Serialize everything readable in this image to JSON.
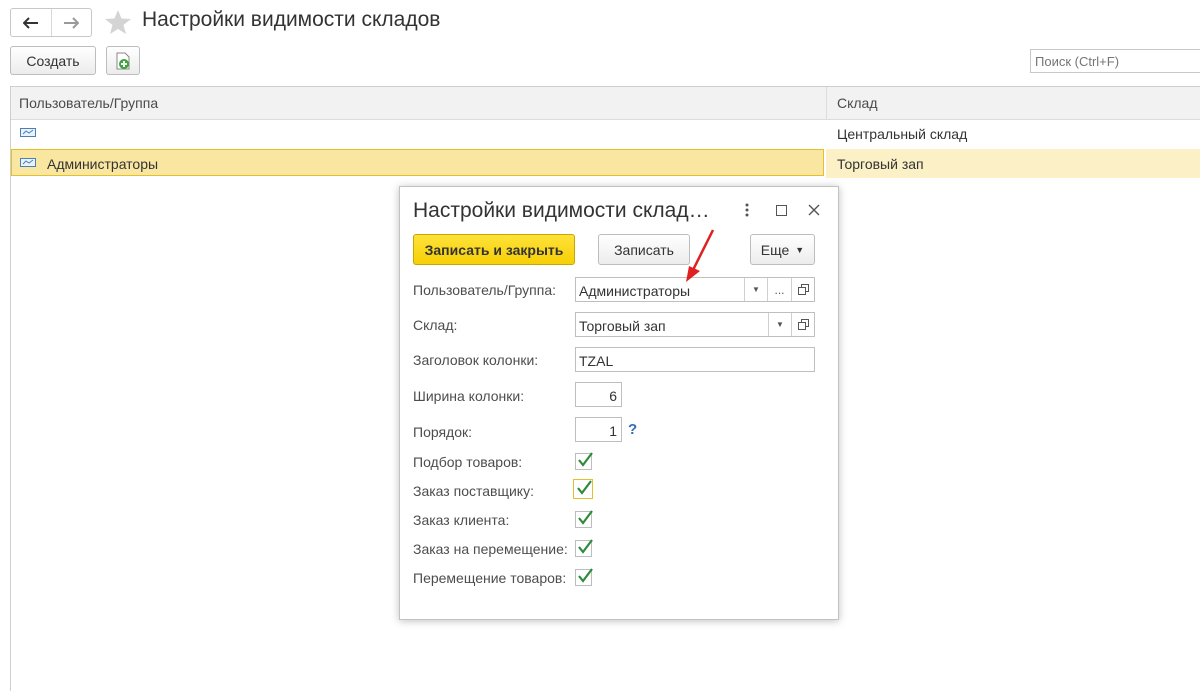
{
  "page": {
    "title": "Настройки видимости складов",
    "create_label": "Создать",
    "search_placeholder": "Поиск (Ctrl+F)"
  },
  "table": {
    "columns": [
      "Пользователь/Группа",
      "Склад"
    ],
    "rows": [
      {
        "user": "",
        "warehouse": "Центральный склад",
        "selected": false
      },
      {
        "user": "Администраторы",
        "warehouse": "Торговый зап",
        "selected": true
      }
    ]
  },
  "dialog": {
    "title": "Настройки видимости склад…",
    "save_close_label": "Записать и закрыть",
    "save_label": "Записать",
    "more_label": "Еще",
    "fields": {
      "user_group": {
        "label": "Пользователь/Группа:",
        "value": "Администраторы"
      },
      "warehouse": {
        "label": "Склад:",
        "value": "Торговый зап"
      },
      "column_header": {
        "label": "Заголовок колонки:",
        "value": "TZAL"
      },
      "column_width": {
        "label": "Ширина колонки:",
        "value": "6"
      },
      "order": {
        "label": "Порядок:",
        "value": "1",
        "help": "?"
      }
    },
    "checkboxes": [
      {
        "label": "Подбор товаров:",
        "checked": true
      },
      {
        "label": "Заказ поставщику:",
        "checked": true
      },
      {
        "label": "Заказ клиента:",
        "checked": true
      },
      {
        "label": "Заказ на перемещение:",
        "checked": true
      },
      {
        "label": "Перемещение товаров:",
        "checked": true
      }
    ]
  },
  "colors": {
    "primary_button": "#f6cf05",
    "selected_row": "#f9e6a0",
    "checkmark": "#2e8b3a",
    "annotation_arrow": "#e02020"
  }
}
